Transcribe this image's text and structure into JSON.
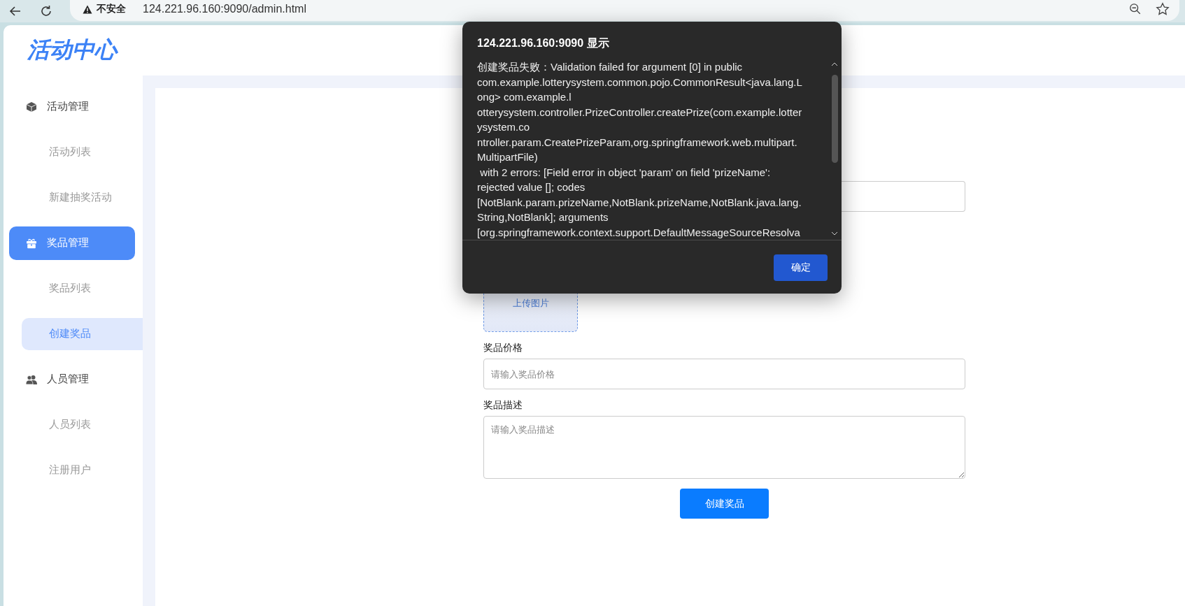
{
  "browser": {
    "security_label": "不安全",
    "url": "124.221.96.160:9090/admin.html"
  },
  "logo": "活动中心",
  "sidebar": {
    "groups": [
      {
        "label": "活动管理",
        "selected": false,
        "children": [
          {
            "label": "活动列表",
            "selected": false
          },
          {
            "label": "新建抽奖活动",
            "selected": false
          }
        ]
      },
      {
        "label": "奖品管理",
        "selected": true,
        "children": [
          {
            "label": "奖品列表",
            "selected": false
          },
          {
            "label": "创建奖品",
            "selected": true
          }
        ]
      },
      {
        "label": "人员管理",
        "selected": false,
        "children": [
          {
            "label": "人员列表",
            "selected": false
          },
          {
            "label": "注册用户",
            "selected": false
          }
        ]
      }
    ]
  },
  "form": {
    "fields": [
      {
        "kind": "input"
      },
      {
        "kind": "upload",
        "label": "上传图片"
      },
      {
        "kind": "input",
        "label": "奖品价格",
        "placeholder": "请输入奖品价格"
      },
      {
        "kind": "textarea",
        "label": "奖品描述",
        "placeholder": "请输入奖品描述"
      }
    ],
    "submit": "创建奖品"
  },
  "dialog": {
    "title": "124.221.96.160:9090 显示",
    "message": "创建奖品失败：Validation failed for argument [0] in public\ncom.example.lotterysystem.common.pojo.CommonResult<java.lang.L\nong> com.example.l\notterysystem.controller.PrizeController.createPrize(com.example.lotter\nysystem.co\nntroller.param.CreatePrizeParam,org.springframework.web.multipart.\nMultipartFile)\n with 2 errors: [Field error in object 'param' on field 'prizeName':\nrejected value []; codes\n[NotBlank.param.prizeName,NotBlank.prizeName,NotBlank.java.lang.\nString,NotBlank]; arguments\n[org.springframework.context.support.DefaultMessageSourceResolva",
    "ok_button": "确定"
  }
}
